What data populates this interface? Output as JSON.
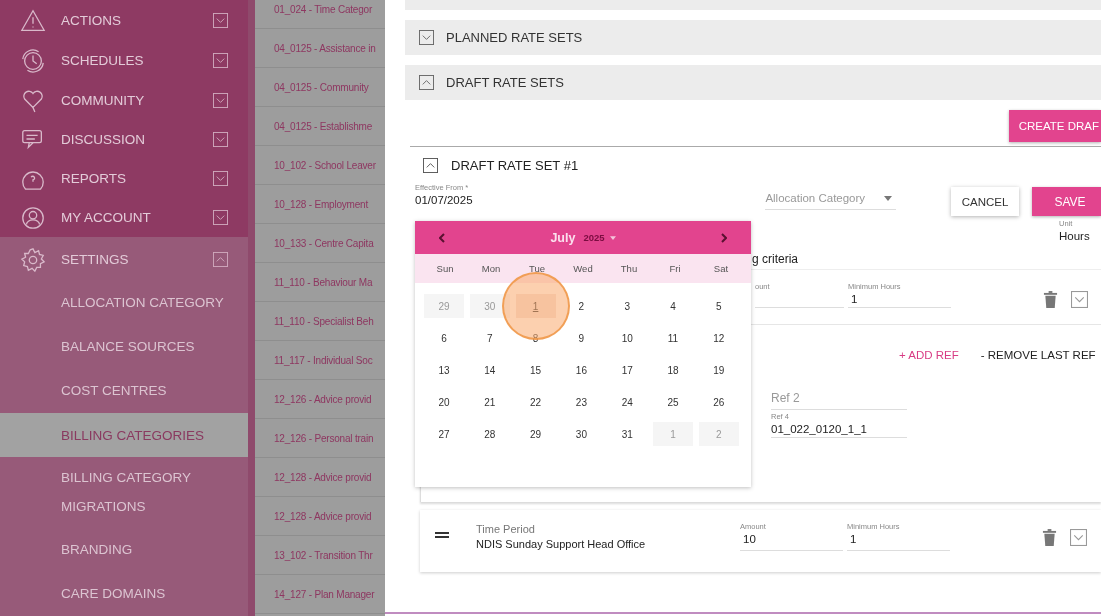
{
  "sidebar": {
    "items": [
      {
        "label": "ACTIONS",
        "expanded": false
      },
      {
        "label": "SCHEDULES",
        "expanded": false
      },
      {
        "label": "COMMUNITY",
        "expanded": false
      },
      {
        "label": "DISCUSSION",
        "expanded": false
      },
      {
        "label": "REPORTS",
        "expanded": false
      },
      {
        "label": "MY ACCOUNT",
        "expanded": false
      },
      {
        "label": "SETTINGS",
        "expanded": true,
        "children": [
          {
            "label": "ALLOCATION CATEGORY",
            "selected": false
          },
          {
            "label": "BALANCE SOURCES",
            "selected": false
          },
          {
            "label": "COST CENTRES",
            "selected": false
          },
          {
            "label": "BILLING CATEGORIES",
            "selected": true
          },
          {
            "label": "BILLING CATEGORY MIGRATIONS",
            "selected": false
          },
          {
            "label": "BRANDING",
            "selected": false
          },
          {
            "label": "CARE DOMAINS",
            "selected": false
          }
        ]
      }
    ]
  },
  "billing_categories": [
    "01_024 - Time Categor",
    "04_0125 - Assistance in",
    "04_0125 - Community",
    "04_0125 - Establishme",
    "10_102 - School Leaver",
    "10_128 - Employment",
    "10_133 - Centre Capita",
    "11_110 - Behaviour Ma",
    "11_110 - Specialist Beh",
    "11_117 - Individual Soc",
    "12_126 - Advice provid",
    "12_126 - Personal train",
    "12_128 - Advice provid",
    "12_128 - Advice provid",
    "13_102 - Transition Thr",
    "14_127 - Plan Manager"
  ],
  "sections": [
    {
      "label": "PLANNED RATE SETS",
      "expanded": false
    },
    {
      "label": "DRAFT RATE SETS",
      "expanded": true
    }
  ],
  "create_button": "CREATE DRAF",
  "draft": {
    "title": "DRAFT RATE SET #1",
    "expanded": true,
    "effective_from": {
      "label": "Effective From *",
      "value": "01/07/2025"
    },
    "allocation_category": {
      "placeholder": "Allocation Category"
    },
    "cancel_button": "CANCEL",
    "save_button": "SAVE",
    "unit": {
      "label": "Unit",
      "value": "Hours"
    },
    "criteria_text": "g criteria",
    "rate": {
      "amount_label": "ount",
      "min_label": "Minimum Hours",
      "min_value": "1",
      "expanded": false
    },
    "add_ref": "+ ADD REF",
    "remove_ref": "- REMOVE LAST REF",
    "refs": [
      {
        "placeholder": "Ref 2"
      },
      {
        "label": "Ref 4",
        "value": "01_022_0120_1_1"
      }
    ],
    "time_period": {
      "label": "Time Period",
      "value": "NDIS Sunday Support Head Office",
      "amount_label": "Amount",
      "amount_value": "10",
      "min_label": "Minimum Hours",
      "min_value": "1",
      "expanded": false
    }
  },
  "calendar": {
    "month": "July",
    "year": "2025",
    "weekdays": [
      "Sun",
      "Mon",
      "Tue",
      "Wed",
      "Thu",
      "Fri",
      "Sat"
    ],
    "weeks": [
      [
        {
          "label": "29",
          "outside": true,
          "selected": false
        },
        {
          "label": "30",
          "outside": true,
          "selected": false
        },
        {
          "label": "1",
          "outside": false,
          "selected": true
        },
        {
          "label": "2",
          "outside": false,
          "selected": false
        },
        {
          "label": "3",
          "outside": false,
          "selected": false
        },
        {
          "label": "4",
          "outside": false,
          "selected": false
        },
        {
          "label": "5",
          "outside": false,
          "selected": false
        }
      ],
      [
        {
          "label": "6",
          "outside": false,
          "selected": false
        },
        {
          "label": "7",
          "outside": false,
          "selected": false
        },
        {
          "label": "8",
          "outside": false,
          "selected": false
        },
        {
          "label": "9",
          "outside": false,
          "selected": false
        },
        {
          "label": "10",
          "outside": false,
          "selected": false
        },
        {
          "label": "11",
          "outside": false,
          "selected": false
        },
        {
          "label": "12",
          "outside": false,
          "selected": false
        }
      ],
      [
        {
          "label": "13",
          "outside": false,
          "selected": false
        },
        {
          "label": "14",
          "outside": false,
          "selected": false
        },
        {
          "label": "15",
          "outside": false,
          "selected": false
        },
        {
          "label": "16",
          "outside": false,
          "selected": false
        },
        {
          "label": "17",
          "outside": false,
          "selected": false
        },
        {
          "label": "18",
          "outside": false,
          "selected": false
        },
        {
          "label": "19",
          "outside": false,
          "selected": false
        }
      ],
      [
        {
          "label": "20",
          "outside": false,
          "selected": false
        },
        {
          "label": "21",
          "outside": false,
          "selected": false
        },
        {
          "label": "22",
          "outside": false,
          "selected": false
        },
        {
          "label": "23",
          "outside": false,
          "selected": false
        },
        {
          "label": "24",
          "outside": false,
          "selected": false
        },
        {
          "label": "25",
          "outside": false,
          "selected": false
        },
        {
          "label": "26",
          "outside": false,
          "selected": false
        }
      ],
      [
        {
          "label": "27",
          "outside": false,
          "selected": false
        },
        {
          "label": "28",
          "outside": false,
          "selected": false
        },
        {
          "label": "29",
          "outside": false,
          "selected": false
        },
        {
          "label": "30",
          "outside": false,
          "selected": false
        },
        {
          "label": "31",
          "outside": false,
          "selected": false
        },
        {
          "label": "1",
          "outside": true,
          "selected": false
        },
        {
          "label": "2",
          "outside": true,
          "selected": false
        }
      ]
    ]
  }
}
